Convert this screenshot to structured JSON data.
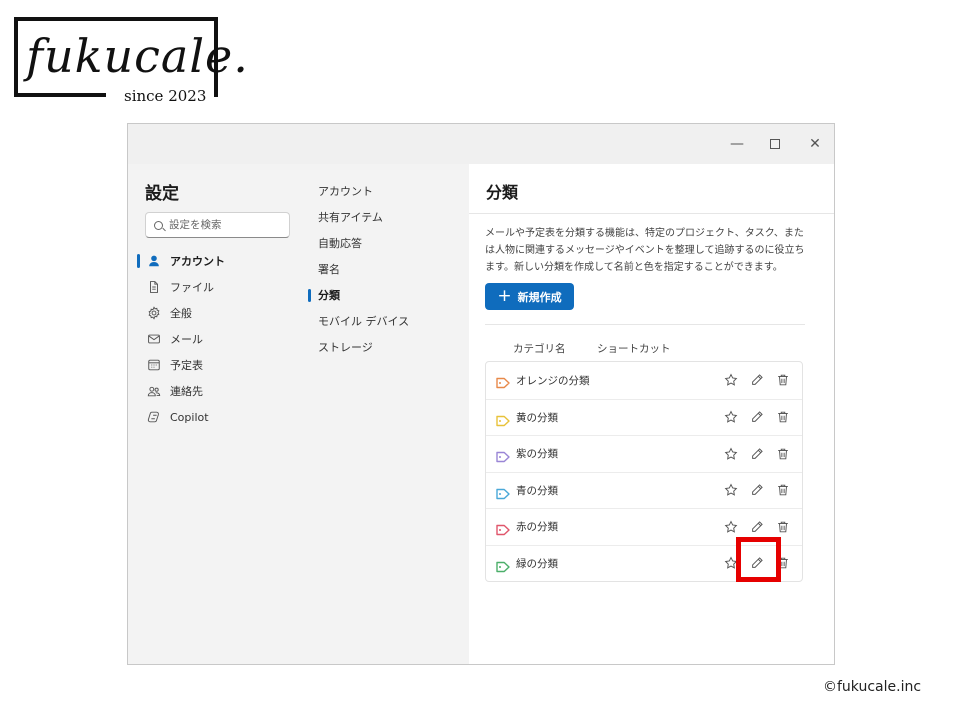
{
  "logo": {
    "text": "fukucale.",
    "since": "since 2023"
  },
  "window": {
    "controls": {
      "minimize": "—",
      "close": "✕"
    }
  },
  "nav": {
    "title": "設定",
    "search_placeholder": "設定を検索",
    "items": [
      {
        "label": "アカウント",
        "icon": "person-icon",
        "active": true
      },
      {
        "label": "ファイル",
        "icon": "file-icon"
      },
      {
        "label": "全般",
        "icon": "gear-icon"
      },
      {
        "label": "メール",
        "icon": "mail-icon"
      },
      {
        "label": "予定表",
        "icon": "calendar-icon"
      },
      {
        "label": "連絡先",
        "icon": "people-icon"
      },
      {
        "label": "Copilot",
        "icon": "copilot-icon"
      }
    ]
  },
  "subnav": {
    "items": [
      {
        "label": "アカウント"
      },
      {
        "label": "共有アイテム"
      },
      {
        "label": "自動応答"
      },
      {
        "label": "署名"
      },
      {
        "label": "分類",
        "active": true
      },
      {
        "label": "モバイル デバイス"
      },
      {
        "label": "ストレージ"
      }
    ]
  },
  "panel": {
    "title": "分類",
    "description": "メールや予定表を分類する機能は、特定のプロジェクト、タスク、または人物に関連するメッセージやイベントを整理して追跡するのに役立ちます。新しい分類を作成して名前と色を指定することができます。",
    "new_button": "新規作成",
    "columns": {
      "category": "カテゴリ名",
      "shortcut": "ショートカット"
    },
    "categories": [
      {
        "name": "オレンジの分類",
        "color": "#e8894a"
      },
      {
        "name": "黄の分類",
        "color": "#e8c23a"
      },
      {
        "name": "紫の分類",
        "color": "#9a86d6"
      },
      {
        "name": "青の分類",
        "color": "#4aa8d8"
      },
      {
        "name": "赤の分類",
        "color": "#e0566b"
      },
      {
        "name": "緑の分類",
        "color": "#4caf6a"
      }
    ]
  },
  "colors": {
    "accent": "#0f6cbd",
    "highlight": "#e60000"
  },
  "copyright": "©fukucale.inc"
}
